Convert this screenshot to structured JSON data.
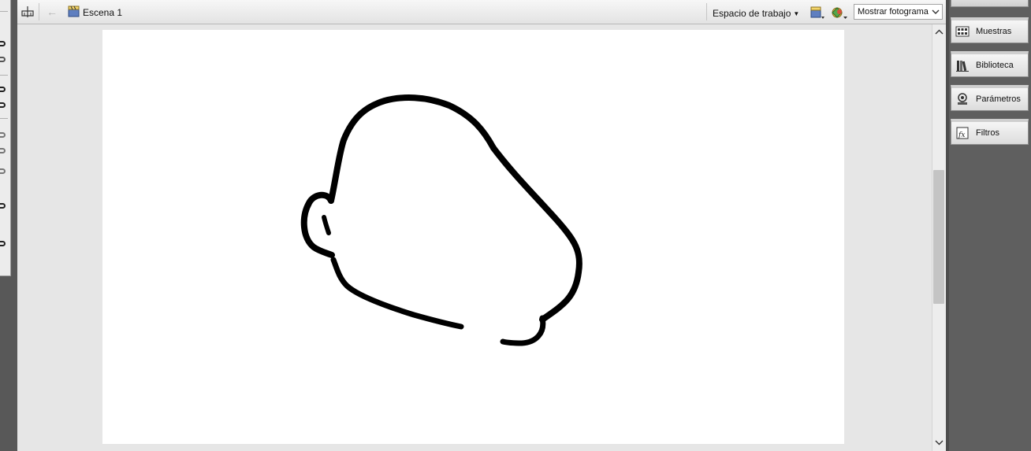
{
  "toolbar": {
    "scene_label": "Escena 1",
    "workspace_label": "Espacio de trabajo",
    "zoom_value": "Mostrar fotograma"
  },
  "panels": [
    {
      "label": "Muestras",
      "icon": "swatches-icon"
    },
    {
      "label": "Biblioteca",
      "icon": "library-icon"
    },
    {
      "label": "Parámetros",
      "icon": "parameters-icon"
    },
    {
      "label": "Filtros",
      "icon": "filters-icon"
    }
  ],
  "colors": {
    "stroke": "#000000",
    "stage": "#ffffff",
    "pasteboard": "#e6e6e6",
    "panel_dark": "#5f5f5f"
  }
}
